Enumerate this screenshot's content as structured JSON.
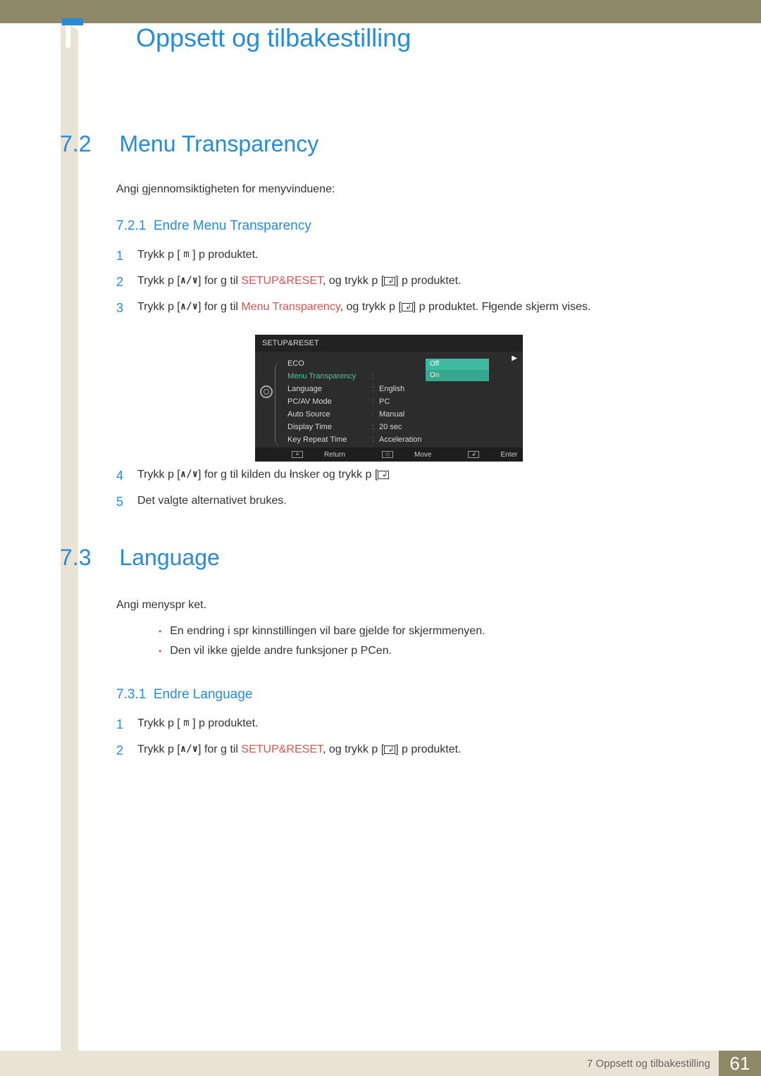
{
  "chapter": {
    "number": "7",
    "title": "Oppsett og tilbakestilling"
  },
  "section72": {
    "num": "7.2",
    "title": "Menu Transparency",
    "intro": "Angi gjennomsiktigheten for menyvinduene:"
  },
  "sub721": {
    "num": "7.2.1",
    "title": "Endre Menu Transparency"
  },
  "steps72": [
    {
      "n": "1",
      "pre": "Trykk p  [ ",
      "btn": "m",
      "post": " ] p  produktet."
    },
    {
      "n": "2",
      "pre": "Trykk p  [",
      "nav": "∧/∨",
      "mid": "] for  g  til  ",
      "hl": "SETUP&RESET",
      "post2": ", og trykk p  [",
      "ent": "icon",
      "post3": "] p  produktet."
    },
    {
      "n": "3",
      "pre": "Trykk p  [",
      "nav": "∧/∨",
      "mid": "] for  g  til  ",
      "hl": "Menu Transparency",
      "post2": ", og trykk p  [",
      "ent": "icon",
      "post3": "] p  produktet. Fłgende skjerm vises."
    }
  ],
  "steps72b": [
    {
      "n": "4",
      "pre": "Trykk p  [",
      "nav": "∧/∨",
      "mid": "] for  g  til kilden du łnsker og trykk p  [",
      "ent": "icon",
      "post": ""
    },
    {
      "n": "5",
      "text": "Det valgte alternativet brukes."
    }
  ],
  "osd": {
    "header": "SETUP&RESET",
    "rows": [
      {
        "label": "ECO",
        "val": ""
      },
      {
        "label": "Menu Transparency",
        "val": "",
        "active": true
      },
      {
        "label": "Language",
        "val": "English"
      },
      {
        "label": "PC/AV Mode",
        "val": "PC"
      },
      {
        "label": "Auto Source",
        "val": "Manual"
      },
      {
        "label": "Display Time",
        "val": "20 sec"
      },
      {
        "label": "Key Repeat Time",
        "val": "Acceleration"
      }
    ],
    "opts": {
      "off": "Off",
      "on": "On"
    },
    "footer": {
      "return": "Return",
      "move": "Move",
      "enter": "Enter"
    }
  },
  "section73": {
    "num": "7.3",
    "title": "Language",
    "intro": "Angi menyspr ket."
  },
  "bullets73": [
    "En endring i spr kinnstillingen vil bare gjelde for skjermmenyen.",
    "Den vil ikke gjelde andre funksjoner p  PCen."
  ],
  "sub731": {
    "num": "7.3.1",
    "title": "Endre Language"
  },
  "steps73": [
    {
      "n": "1",
      "pre": "Trykk p  [ ",
      "btn": "m",
      "post": " ] p  produktet."
    },
    {
      "n": "2",
      "pre": "Trykk p  [",
      "nav": "∧/∨",
      "mid": "] for  g  til  ",
      "hl": "SETUP&RESET",
      "post2": ", og trykk p  [",
      "ent": "icon",
      "post3": "] p  produktet."
    }
  ],
  "footer": {
    "text": "7 Oppsett og tilbakestilling",
    "page": "61"
  }
}
